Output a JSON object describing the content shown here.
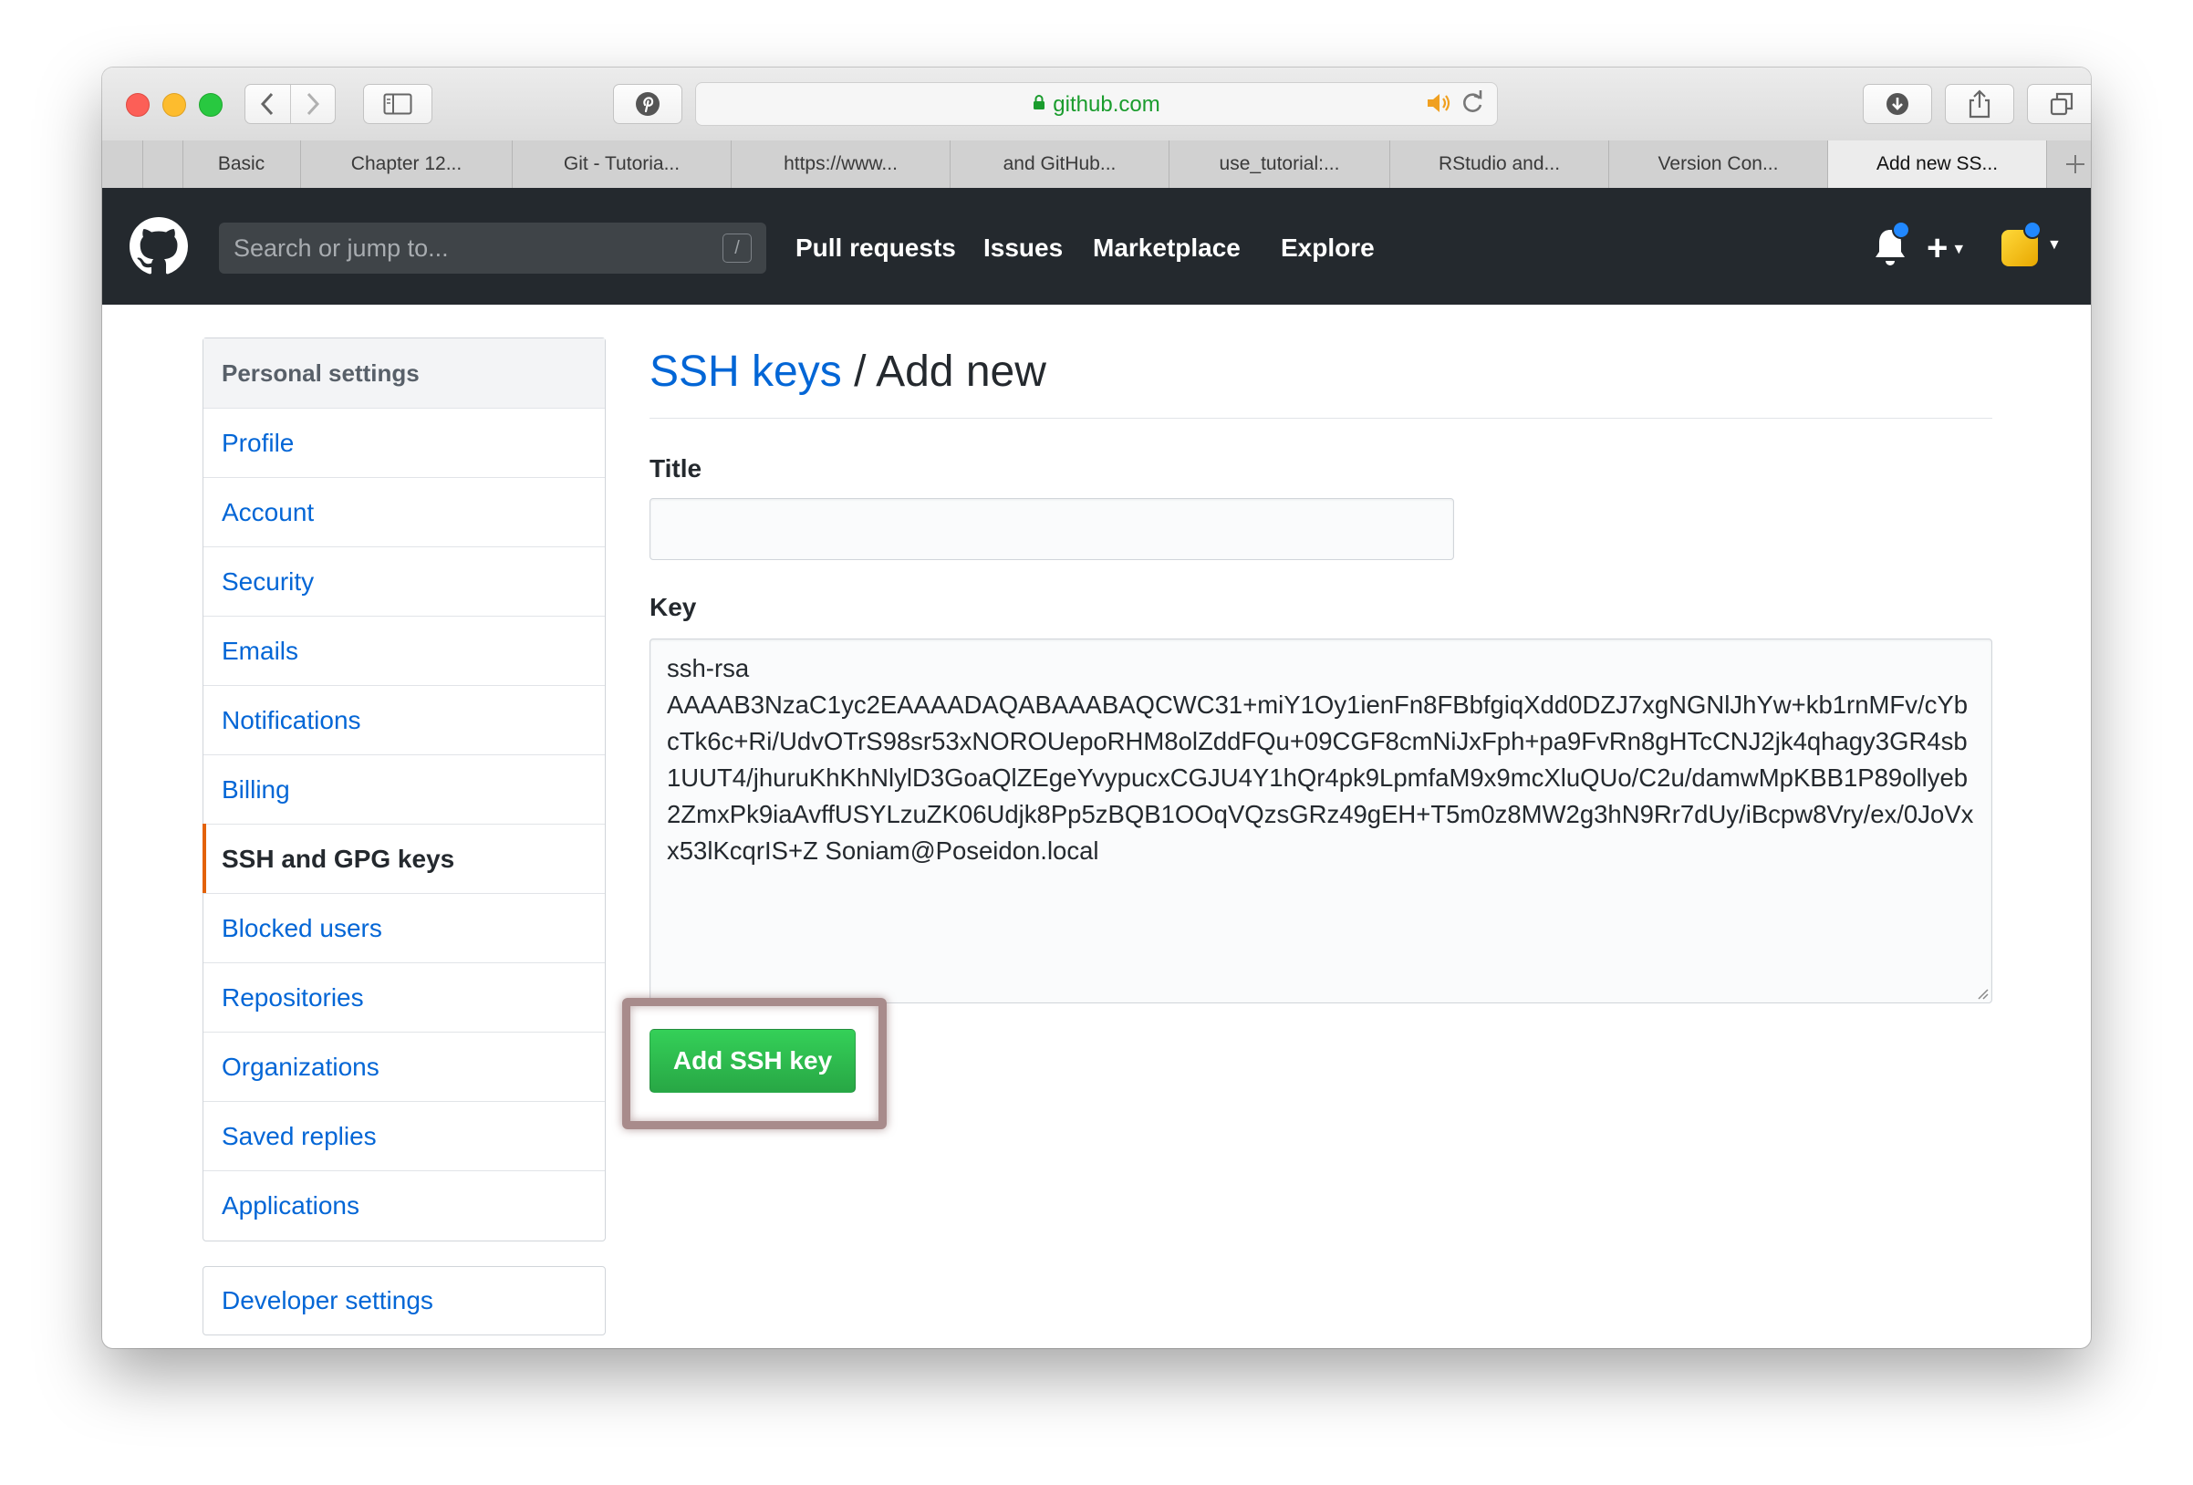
{
  "browser": {
    "url": "github.com",
    "tabs": [
      {
        "label": "Basic"
      },
      {
        "label": "Chapter 12..."
      },
      {
        "label": "Git - Tutoria..."
      },
      {
        "label": "https://www..."
      },
      {
        "label": "and GitHub..."
      },
      {
        "label": "use_tutorial:..."
      },
      {
        "label": "RStudio and..."
      },
      {
        "label": "Version Con..."
      },
      {
        "label": "Add new SS..."
      }
    ],
    "active_tab_index": 8
  },
  "header": {
    "search_placeholder": "Search or jump to...",
    "search_shortcut": "/",
    "nav": {
      "pull_requests": "Pull requests",
      "issues": "Issues",
      "marketplace": "Marketplace",
      "explore": "Explore"
    },
    "plus_label": "+"
  },
  "sidebar": {
    "heading": "Personal settings",
    "items": [
      {
        "label": "Profile"
      },
      {
        "label": "Account"
      },
      {
        "label": "Security"
      },
      {
        "label": "Emails"
      },
      {
        "label": "Notifications"
      },
      {
        "label": "Billing"
      },
      {
        "label": "SSH and GPG keys"
      },
      {
        "label": "Blocked users"
      },
      {
        "label": "Repositories"
      },
      {
        "label": "Organizations"
      },
      {
        "label": "Saved replies"
      },
      {
        "label": "Applications"
      }
    ],
    "selected_index": 6,
    "developer_settings": "Developer settings"
  },
  "main": {
    "breadcrumb_link": "SSH keys",
    "breadcrumb_sep": " / ",
    "breadcrumb_current": "Add new",
    "title_label": "Title",
    "title_value": "",
    "key_label": "Key",
    "key_value": "ssh-rsa\nAAAAB3NzaC1yc2EAAAADAQABAAABAQCWC31+miY1Oy1ienFn8FBbfgiqXdd0DZJ7xgNGNlJhYw+kb1rnMFv/cYbcTk6c+Ri/UdvOTrS98sr53xNOROUepoRHM8olZddFQu+09CGF8cmNiJxFph+pa9FvRn8gHTcCNJ2jk4qhagy3GR4sb1UUT4/jhuruKhKhNlylD3GoaQlZEgeYvypucxCGJU4Y1hQr4pk9LpmfaM9x9mcXluQUo/C2u/damwMpKBB1P89ollyeb2ZmxPk9iaAvffUSYLzuZK06Udjk8Pp5zBQB1OOqVQzsGRz49gEH+T5m0z8MW2g3hN9Rr7dUy/iBcpw8Vry/ex/0JoVxx53lKcqrIS+Z Soniam@Poseidon.local",
    "submit_label": "Add SSH key"
  },
  "colors": {
    "header_bg": "#24292e",
    "link": "#0366d6",
    "selected_marker": "#e36209",
    "button_green": "#28a745",
    "highlight_frame": "#a88b8b"
  }
}
